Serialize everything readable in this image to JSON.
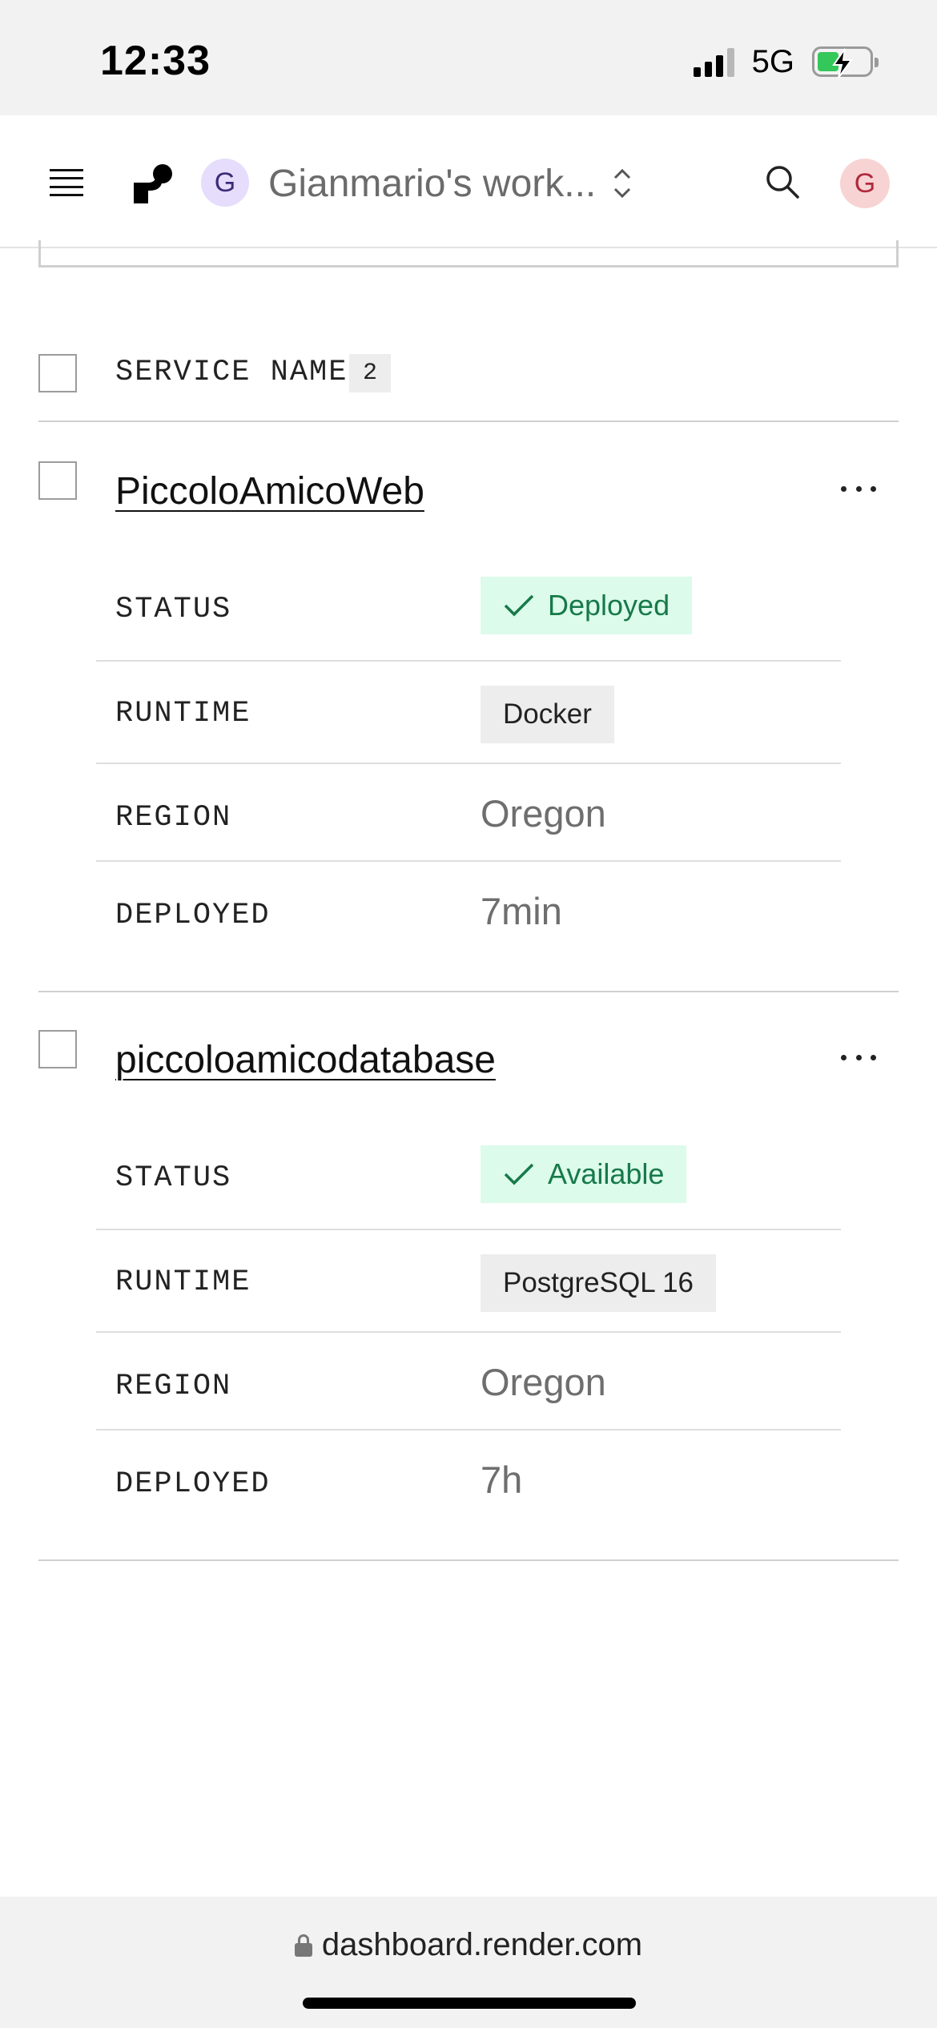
{
  "status_bar": {
    "time": "12:33",
    "network": "5G",
    "battery_icon": "battery-charging-icon",
    "signal_icon": "cellular-signal-icon"
  },
  "header": {
    "menu_icon": "hamburger-menu-icon",
    "logo_icon": "render-logo-icon",
    "workspace_avatar_letter": "G",
    "workspace_name": "Gianmario's work...",
    "switcher_icon": "chevron-up-down-icon",
    "search_icon": "search-icon",
    "user_avatar_letter": "G"
  },
  "table": {
    "header_label": "SERVICE NAME",
    "count": "2"
  },
  "services": [
    {
      "name": "PiccoloAmicoWeb",
      "fields": {
        "status_label": "STATUS",
        "status_value": "Deployed",
        "runtime_label": "RUNTIME",
        "runtime_value": "Docker",
        "region_label": "REGION",
        "region_value": "Oregon",
        "deployed_label": "DEPLOYED",
        "deployed_value": "7min"
      }
    },
    {
      "name": "piccoloamicodatabase",
      "fields": {
        "status_label": "STATUS",
        "status_value": "Available",
        "runtime_label": "RUNTIME",
        "runtime_value": "PostgreSQL 16",
        "region_label": "REGION",
        "region_value": "Oregon",
        "deployed_label": "DEPLOYED",
        "deployed_value": "7h"
      }
    }
  ],
  "browser": {
    "url": "dashboard.render.com",
    "lock_icon": "lock-icon"
  },
  "colors": {
    "status_ok_bg": "#dcfbea",
    "status_ok_text": "#17794a",
    "workspace_avatar_bg": "#e6dcfb",
    "user_avatar_bg": "#f8d3d3"
  }
}
